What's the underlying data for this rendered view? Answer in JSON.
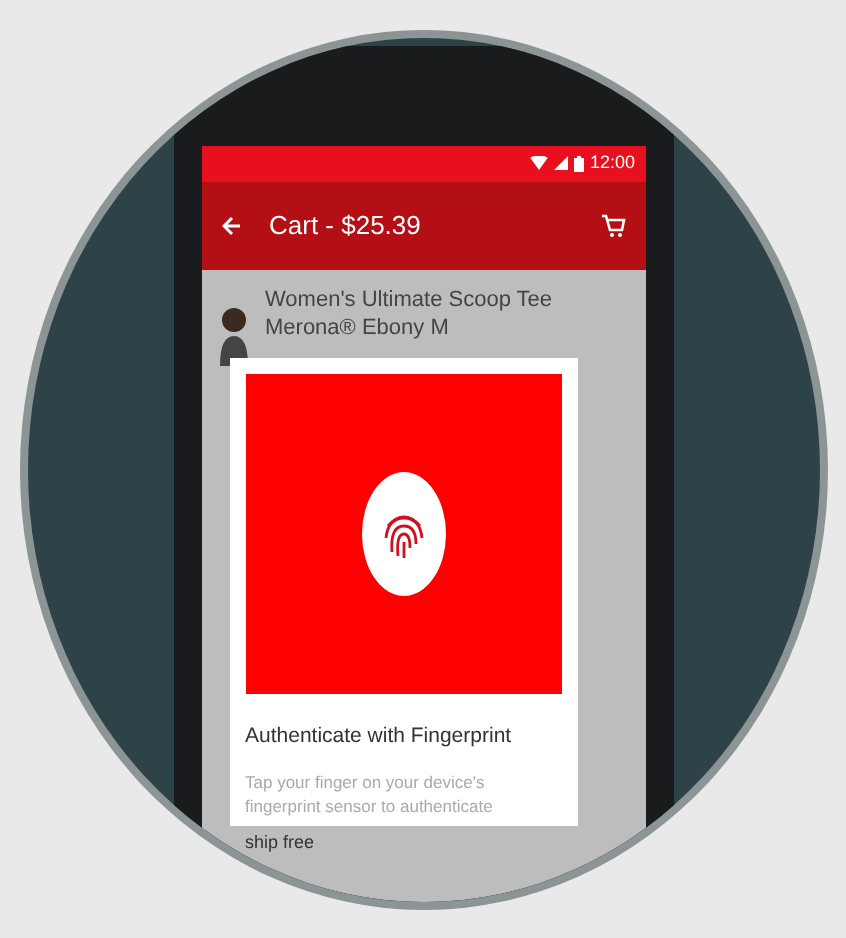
{
  "status_bar": {
    "time": "12:00"
  },
  "app_bar": {
    "title": "Cart - $25.39"
  },
  "cart_items": [
    {
      "title": "Women's Ultimate Scoop Tee",
      "subtitle": "Merona® Ebony M"
    }
  ],
  "behind_text": "ship free",
  "dialog": {
    "title": "Authenticate with Fingerprint",
    "message": "Tap your finger on your device's fingerprint sensor to authenticate"
  }
}
